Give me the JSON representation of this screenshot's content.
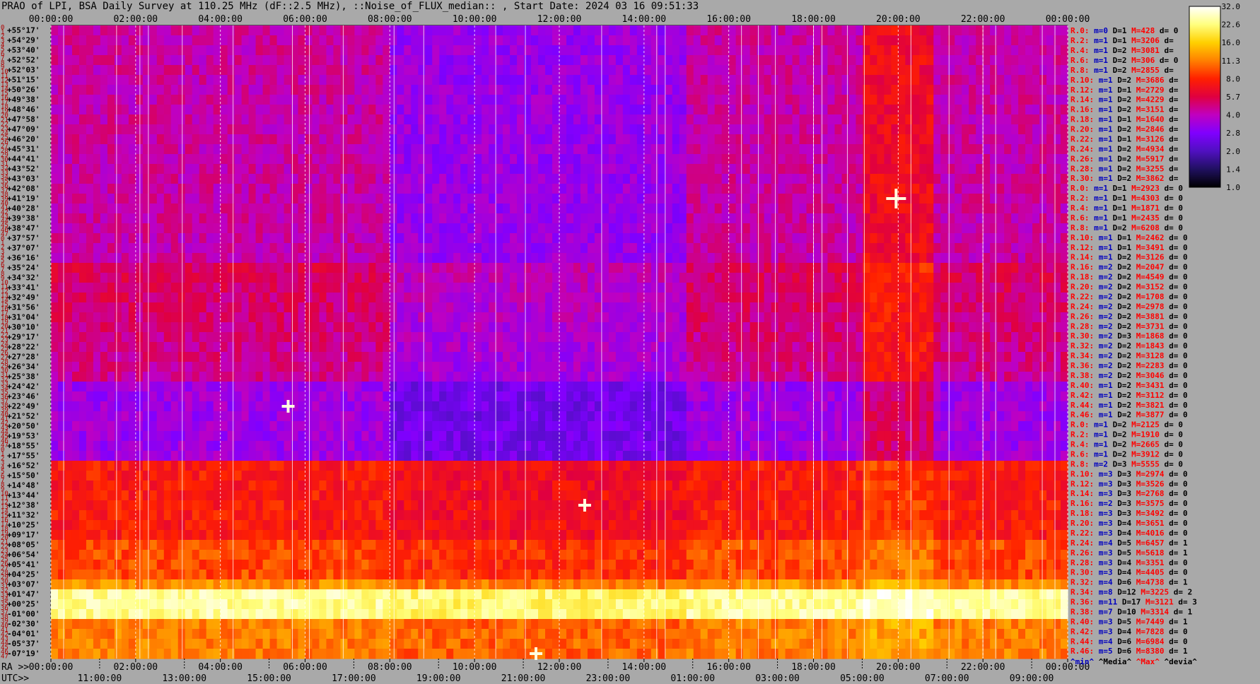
{
  "title": "PRAO of LPI, BSA Daily Survey at 110.25 MHz (dF::2.5 MHz), ::Noise_of_FLUX_median:: , Start Date: 2024 03 16 09:51:33",
  "chart_data": {
    "type": "heatmap",
    "title": "PRAO of LPI, BSA Daily Survey at 110.25 MHz (dF::2.5 MHz), ::Noise_of_FLUX_median:: , Start Date: 2024 03 16 09:51:33",
    "x_top_ticks": [
      "00:00:00",
      "02:00:00",
      "04:00:00",
      "06:00:00",
      "08:00:00",
      "10:00:00",
      "12:00:00",
      "14:00:00",
      "16:00:00",
      "18:00:00",
      "20:00:00",
      "22:00:00",
      "00:00:00"
    ],
    "x_bottom_ra_prefix": "RA >>",
    "x_bottom_ra_ticks": [
      "00:00:00",
      "02:00:00",
      "04:00:00",
      "06:00:00",
      "08:00:00",
      "10:00:00",
      "12:00:00",
      "14:00:00",
      "16:00:00",
      "18:00:00",
      "20:00:00",
      "22:00:00",
      "00:00:00"
    ],
    "x_bottom_utc_prefix": "UTC>>",
    "x_bottom_utc_ticks": [
      "11:00:00",
      "13:00:00",
      "15:00:00",
      "17:00:00",
      "19:00:00",
      "21:00:00",
      "23:00:00",
      "01:00:00",
      "03:00:00",
      "05:00:00",
      "07:00:00",
      "09:00:00"
    ],
    "dec_labels": [
      "+55°17'",
      "+54°29'",
      "+53°40'",
      "+52°52'",
      "+52°03'",
      "+51°15'",
      "+50°26'",
      "+49°38'",
      "+48°46'",
      "+47°58'",
      "+47°09'",
      "+46°20'",
      "+45°31'",
      "+44°41'",
      "+43°52'",
      "+43°03'",
      "+42°08'",
      "+41°19'",
      "+40°28'",
      "+39°38'",
      "+38°47'",
      "+37°57'",
      "+37°07'",
      "+36°16'",
      "+35°24'",
      "+34°32'",
      "+33°41'",
      "+32°49'",
      "+31°56'",
      "+31°04'",
      "+30°10'",
      "+29°17'",
      "+28°22'",
      "+27°28'",
      "+26°34'",
      "+25°38'",
      "+24°42'",
      "+23°46'",
      "+22°49'",
      "+21°52'",
      "+20°50'",
      "+19°53'",
      "+18°55'",
      "+17°55'",
      "+16°52'",
      "+15°50'",
      "+14°48'",
      "+13°44'",
      "+12°38'",
      "+11°32'",
      "+10°25'",
      "+09°17'",
      "+08°05'",
      "+06°54'",
      "+05°41'",
      "+04°25'",
      "+03°07'",
      "+01°47'",
      "+00°25'",
      "-01°00'",
      "-02°30'",
      "-04°01'",
      "-05°37'",
      "-07°19'"
    ],
    "row_indices": [
      "0",
      "1",
      "2",
      "3",
      "4",
      "5",
      "6",
      "7",
      "8",
      "9",
      "10",
      "11",
      "12",
      "13",
      "14",
      "15",
      "16",
      "17",
      "18",
      "19",
      "20",
      "21",
      "22",
      "23",
      "24",
      "25",
      "26",
      "27",
      "28",
      "29",
      "30",
      "31",
      "32",
      "33",
      "34",
      "35",
      "36",
      "37",
      "38",
      "39",
      "40",
      "41",
      "42",
      "43",
      "44",
      "45",
      "46",
      "47",
      "0",
      "1",
      "2",
      "3",
      "4",
      "5",
      "6",
      "7",
      "8",
      "9",
      "10",
      "11",
      "12",
      "13",
      "14",
      "15",
      "16",
      "17",
      "18",
      "19",
      "20",
      "21",
      "22",
      "23",
      "24",
      "25",
      "26",
      "27",
      "28",
      "29",
      "30",
      "31",
      "32",
      "33",
      "34",
      "35",
      "36",
      "37",
      "38",
      "39",
      "40",
      "41",
      "42",
      "43",
      "44",
      "45",
      "46",
      "47",
      "0",
      "1",
      "2",
      "3",
      "4",
      "5",
      "6",
      "7",
      "8",
      "9",
      "10",
      "11",
      "12",
      "13",
      "14",
      "15",
      "16",
      "17",
      "18",
      "19",
      "20",
      "21",
      "22",
      "23",
      "24",
      "25",
      "26",
      "27",
      "28",
      "29",
      "30",
      "31",
      "32",
      "33",
      "34",
      "35",
      "36",
      "37",
      "38",
      "39",
      "40",
      "41",
      "42",
      "43",
      "44",
      "45",
      "46",
      "47"
    ],
    "colorbar": {
      "ticks": [
        "32.0",
        "22.6",
        "16.0",
        "11.3",
        "8.0",
        "5.7",
        "4.0",
        "2.8",
        "2.0",
        "1.4",
        "1.0"
      ],
      "colors": [
        "#ffffff",
        "#ffff80",
        "#ffd000",
        "#ff8000",
        "#ff2000",
        "#e00040",
        "#c000c0",
        "#8000ff",
        "#5010c0",
        "#201060",
        "#000000"
      ]
    },
    "right_legend": [
      {
        "r": "R.0:",
        "m": "m=0",
        "d": "D=1",
        "M": "M=428",
        "dv": "d= 0"
      },
      {
        "r": "R.2:",
        "m": "m=1",
        "d": "D=1",
        "M": "M=3206",
        "dv": "d="
      },
      {
        "r": "R.4:",
        "m": "m=1",
        "d": "D=2",
        "M": "M=3081",
        "dv": "d="
      },
      {
        "r": "R.6:",
        "m": "m=1",
        "d": "D=2",
        "M": "M=306",
        "dv": "d= 0"
      },
      {
        "r": "R.8:",
        "m": "m=1",
        "d": "D=2",
        "M": "M=2855",
        "dv": "d="
      },
      {
        "r": "R.10:",
        "m": "m=1",
        "d": "D=2",
        "M": "M=3686",
        "dv": "d="
      },
      {
        "r": "R.12:",
        "m": "m=1",
        "d": "D=1",
        "M": "M=2729",
        "dv": "d="
      },
      {
        "r": "R.14:",
        "m": "m=1",
        "d": "D=2",
        "M": "M=4229",
        "dv": "d="
      },
      {
        "r": "R.16:",
        "m": "m=1",
        "d": "D=2",
        "M": "M=3151",
        "dv": "d="
      },
      {
        "r": "R.18:",
        "m": "m=1",
        "d": "D=1",
        "M": "M=1640",
        "dv": "d="
      },
      {
        "r": "R.20:",
        "m": "m=1",
        "d": "D=2",
        "M": "M=2846",
        "dv": "d="
      },
      {
        "r": "R.22:",
        "m": "m=1",
        "d": "D=1",
        "M": "M=3126",
        "dv": "d="
      },
      {
        "r": "R.24:",
        "m": "m=1",
        "d": "D=2",
        "M": "M=4934",
        "dv": "d="
      },
      {
        "r": "R.26:",
        "m": "m=1",
        "d": "D=2",
        "M": "M=5917",
        "dv": "d="
      },
      {
        "r": "R.28:",
        "m": "m=1",
        "d": "D=2",
        "M": "M=3255",
        "dv": "d="
      },
      {
        "r": "R.30:",
        "m": "m=1",
        "d": "D=2",
        "M": "M=3862",
        "dv": "d="
      },
      {
        "r": "R.0:",
        "m": "m=1",
        "d": "D=1",
        "M": "M=2923",
        "dv": "d= 0"
      },
      {
        "r": "R.2:",
        "m": "m=1",
        "d": "D=1",
        "M": "M=4303",
        "dv": "d= 0"
      },
      {
        "r": "R.4:",
        "m": "m=1",
        "d": "D=1",
        "M": "M=1871",
        "dv": "d= 0"
      },
      {
        "r": "R.6:",
        "m": "m=1",
        "d": "D=1",
        "M": "M=2435",
        "dv": "d= 0"
      },
      {
        "r": "R.8:",
        "m": "m=1",
        "d": "D=2",
        "M": "M=6208",
        "dv": "d= 0"
      },
      {
        "r": "R.10:",
        "m": "m=1",
        "d": "D=1",
        "M": "M=2462",
        "dv": "d= 0"
      },
      {
        "r": "R.12:",
        "m": "m=1",
        "d": "D=1",
        "M": "M=3491",
        "dv": "d= 0"
      },
      {
        "r": "R.14:",
        "m": "m=1",
        "d": "D=2",
        "M": "M=3126",
        "dv": "d= 0"
      },
      {
        "r": "R.16:",
        "m": "m=2",
        "d": "D=2",
        "M": "M=2047",
        "dv": "d= 0"
      },
      {
        "r": "R.18:",
        "m": "m=2",
        "d": "D=2",
        "M": "M=4549",
        "dv": "d= 0"
      },
      {
        "r": "R.20:",
        "m": "m=2",
        "d": "D=2",
        "M": "M=3152",
        "dv": "d= 0"
      },
      {
        "r": "R.22:",
        "m": "m=2",
        "d": "D=2",
        "M": "M=1708",
        "dv": "d= 0"
      },
      {
        "r": "R.24:",
        "m": "m=2",
        "d": "D=2",
        "M": "M=2978",
        "dv": "d= 0"
      },
      {
        "r": "R.26:",
        "m": "m=2",
        "d": "D=2",
        "M": "M=3881",
        "dv": "d= 0"
      },
      {
        "r": "R.28:",
        "m": "m=2",
        "d": "D=2",
        "M": "M=3731",
        "dv": "d= 0"
      },
      {
        "r": "R.30:",
        "m": "m=2",
        "d": "D=3",
        "M": "M=1868",
        "dv": "d= 0"
      },
      {
        "r": "R.32:",
        "m": "m=2",
        "d": "D=2",
        "M": "M=1843",
        "dv": "d= 0"
      },
      {
        "r": "R.34:",
        "m": "m=2",
        "d": "D=2",
        "M": "M=3128",
        "dv": "d= 0"
      },
      {
        "r": "R.36:",
        "m": "m=2",
        "d": "D=2",
        "M": "M=2283",
        "dv": "d= 0"
      },
      {
        "r": "R.38:",
        "m": "m=2",
        "d": "D=2",
        "M": "M=3046",
        "dv": "d= 0"
      },
      {
        "r": "R.40:",
        "m": "m=1",
        "d": "D=2",
        "M": "M=3431",
        "dv": "d= 0"
      },
      {
        "r": "R.42:",
        "m": "m=1",
        "d": "D=2",
        "M": "M=3112",
        "dv": "d= 0"
      },
      {
        "r": "R.44:",
        "m": "m=1",
        "d": "D=2",
        "M": "M=3821",
        "dv": "d= 0"
      },
      {
        "r": "R.46:",
        "m": "m=1",
        "d": "D=2",
        "M": "M=3877",
        "dv": "d= 0"
      },
      {
        "r": "R.0:",
        "m": "m=1",
        "d": "D=2",
        "M": "M=2125",
        "dv": "d= 0"
      },
      {
        "r": "R.2:",
        "m": "m=1",
        "d": "D=2",
        "M": "M=1910",
        "dv": "d= 0"
      },
      {
        "r": "R.4:",
        "m": "m=1",
        "d": "D=2",
        "M": "M=2665",
        "dv": "d= 0"
      },
      {
        "r": "R.6:",
        "m": "m=1",
        "d": "D=2",
        "M": "M=3912",
        "dv": "d= 0"
      },
      {
        "r": "R.8:",
        "m": "m=2",
        "d": "D=3",
        "M": "M=5555",
        "dv": "d= 0"
      },
      {
        "r": "R.10:",
        "m": "m=3",
        "d": "D=3",
        "M": "M=2974",
        "dv": "d= 0"
      },
      {
        "r": "R.12:",
        "m": "m=3",
        "d": "D=3",
        "M": "M=3526",
        "dv": "d= 0"
      },
      {
        "r": "R.14:",
        "m": "m=3",
        "d": "D=3",
        "M": "M=2768",
        "dv": "d= 0"
      },
      {
        "r": "R.16:",
        "m": "m=2",
        "d": "D=3",
        "M": "M=3575",
        "dv": "d= 0"
      },
      {
        "r": "R.18:",
        "m": "m=3",
        "d": "D=3",
        "M": "M=3492",
        "dv": "d= 0"
      },
      {
        "r": "R.20:",
        "m": "m=3",
        "d": "D=4",
        "M": "M=3651",
        "dv": "d= 0"
      },
      {
        "r": "R.22:",
        "m": "m=3",
        "d": "D=4",
        "M": "M=4016",
        "dv": "d= 0"
      },
      {
        "r": "R.24:",
        "m": "m=4",
        "d": "D=5",
        "M": "M=6457",
        "dv": "d= 1"
      },
      {
        "r": "R.26:",
        "m": "m=3",
        "d": "D=5",
        "M": "M=5618",
        "dv": "d= 1"
      },
      {
        "r": "R.28:",
        "m": "m=3",
        "d": "D=4",
        "M": "M=3351",
        "dv": "d= 0"
      },
      {
        "r": "R.30:",
        "m": "m=3",
        "d": "D=4",
        "M": "M=4405",
        "dv": "d= 0"
      },
      {
        "r": "R.32:",
        "m": "m=4",
        "d": "D=6",
        "M": "M=4738",
        "dv": "d= 1"
      },
      {
        "r": "R.34:",
        "m": "m=8",
        "d": "D=12",
        "M": "M=3225",
        "dv": "d= 2"
      },
      {
        "r": "R.36:",
        "m": "m=11",
        "d": "D=17",
        "M": "M=3121",
        "dv": "d= 3"
      },
      {
        "r": "R.38:",
        "m": "m=7",
        "d": "D=10",
        "M": "M=3314",
        "dv": "d= 1"
      },
      {
        "r": "R.40:",
        "m": "m=3",
        "d": "D=5",
        "M": "M=7449",
        "dv": "d= 1"
      },
      {
        "r": "R.42:",
        "m": "m=3",
        "d": "D=4",
        "M": "M=7828",
        "dv": "d= 0"
      },
      {
        "r": "R.44:",
        "m": "m=4",
        "d": "D=6",
        "M": "M=6984",
        "dv": "d= 0"
      },
      {
        "r": "R.46:",
        "m": "m=5",
        "d": "D=6",
        "M": "M=8380",
        "dv": "d= 1"
      }
    ],
    "legend_footer": [
      "^min^",
      "^Media^",
      "^Max^",
      "^devia^"
    ],
    "legend_colors": {
      "r": "#ff0000",
      "m": "#0000c0",
      "d": "#000000",
      "M": "#ff0000",
      "dv": "#000000"
    },
    "vertical_lines_hours": [
      0.3,
      1.55,
      2.1,
      2.3,
      3.1,
      4.3,
      5.7,
      6.1,
      6.9,
      8.1,
      8.8,
      10.5,
      11.2,
      13.0,
      14.3,
      14.5,
      16.3,
      16.7,
      17.1,
      18.0,
      18.2,
      18.8,
      19.2,
      20.3,
      21.2,
      22.0,
      22.3,
      23.4,
      23.7
    ],
    "hot_spots": [
      {
        "hour": 19.95,
        "row": 17,
        "size": 2
      },
      {
        "hour": 5.6,
        "row": 38,
        "size": 1
      },
      {
        "hour": 12.6,
        "row": 48,
        "size": 1
      },
      {
        "hour": 11.45,
        "row": 63,
        "size": 1
      }
    ]
  }
}
